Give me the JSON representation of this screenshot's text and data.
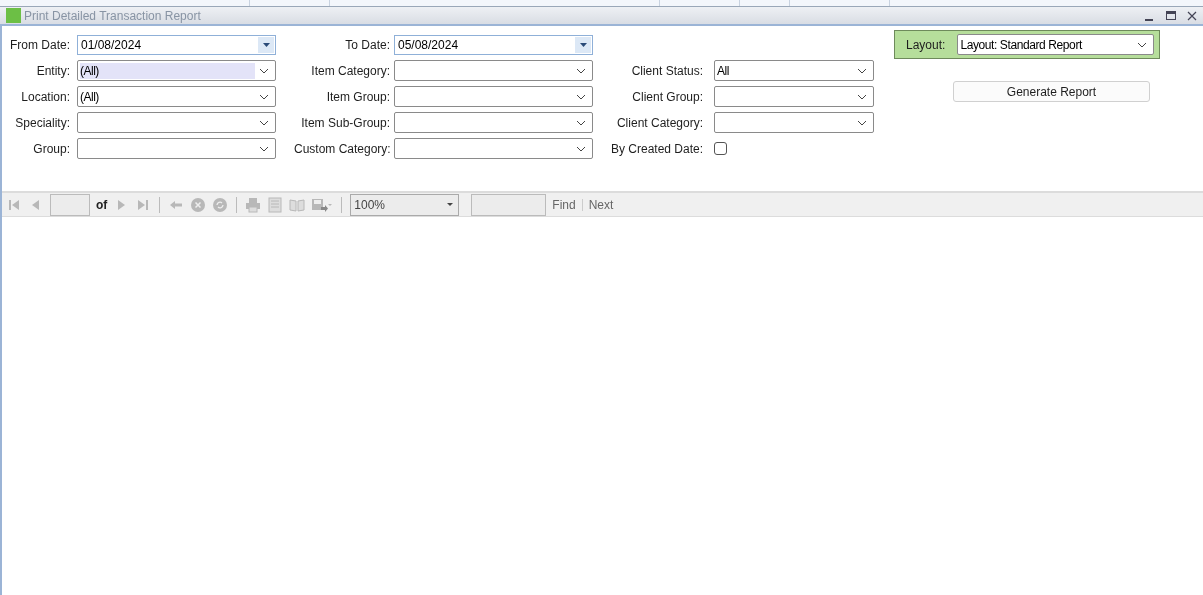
{
  "window": {
    "title": "Print Detailed Transaction Report"
  },
  "form": {
    "columns": [
      [
        {
          "kind": "date",
          "label": "From Date:",
          "value": "01/08/2024"
        },
        {
          "kind": "combo",
          "label": "Entity:",
          "value": "(All)",
          "focused": true
        },
        {
          "kind": "combo",
          "label": "Location:",
          "value": "(All)",
          "focused": false
        },
        {
          "kind": "combo",
          "label": "Speciality:",
          "focused": false
        },
        {
          "kind": "combo",
          "label": "Group:",
          "focused": false
        }
      ],
      [
        {
          "kind": "date",
          "label": "To Date:",
          "value": "05/08/2024"
        },
        {
          "kind": "combo",
          "label": "Item Category:",
          "focused": false
        },
        {
          "kind": "combo",
          "label": "Item Group:",
          "focused": false
        },
        {
          "kind": "combo",
          "label": "Item Sub-Group:",
          "focused": false
        },
        {
          "kind": "combo",
          "label": "Custom Category:",
          "focused": false
        }
      ],
      [
        {
          "kind": "spacer"
        },
        {
          "kind": "combo",
          "label": "Client Status:",
          "value": "All",
          "focused": false
        },
        {
          "kind": "combo",
          "label": "Client Group:",
          "focused": false
        },
        {
          "kind": "combo",
          "label": "Client Category:",
          "focused": false
        },
        {
          "kind": "checkbox",
          "label": "By Created Date:",
          "checked": false
        }
      ]
    ],
    "layout": {
      "label": "Layout:",
      "value": "Layout: Standard Report"
    },
    "generate_button": "Generate Report"
  },
  "toolbar": {
    "items": [
      {
        "kind": "first",
        "disabled": true
      },
      {
        "kind": "prev",
        "disabled": true
      },
      {
        "kind": "page"
      },
      {
        "kind": "of",
        "text": "of"
      },
      {
        "kind": "next",
        "disabled": true
      },
      {
        "kind": "last",
        "disabled": true
      },
      {
        "kind": "sep"
      },
      {
        "kind": "back",
        "disabled": true
      },
      {
        "kind": "stop",
        "disabled": true
      },
      {
        "kind": "refresh",
        "disabled": true
      },
      {
        "kind": "sep"
      },
      {
        "kind": "print",
        "disabled": true
      },
      {
        "kind": "layout",
        "disabled": true
      },
      {
        "kind": "setup",
        "disabled": true
      },
      {
        "kind": "export",
        "disabled": true
      },
      {
        "kind": "sep"
      },
      {
        "kind": "zoom",
        "value": "100%"
      },
      {
        "kind": "find"
      },
      {
        "kind": "link",
        "text": "Find"
      },
      {
        "kind": "bar"
      },
      {
        "kind": "link",
        "text": "Next"
      }
    ]
  }
}
